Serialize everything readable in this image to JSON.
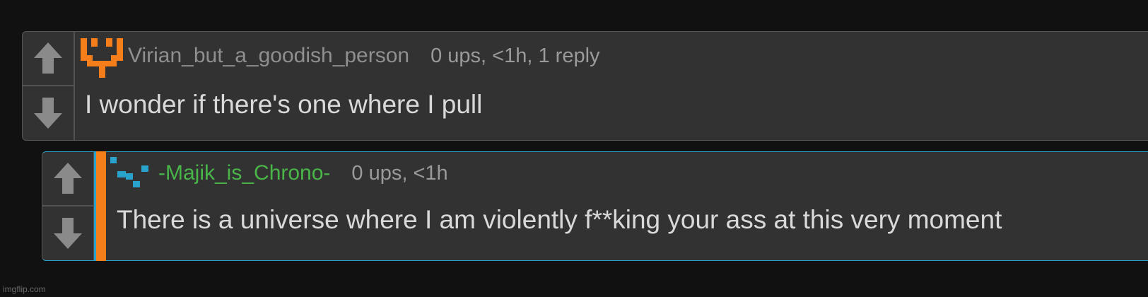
{
  "colors": {
    "page_bg": "#111112",
    "card_bg": "#323232",
    "accent_orange": "#f57d1a",
    "reply_border": "#29a3cc",
    "username_green": "#49b549",
    "text": "#d9d9d9",
    "muted": "#9a9a9a"
  },
  "comments": [
    {
      "avatar_icon": "orange-pixel-avatar-icon",
      "username": "Virian_but_a_goodish_person",
      "stats": "0 ups, <1h, 1 reply",
      "text": "I wonder if there's one where I pull",
      "upvote_icon": "arrow-up-icon",
      "downvote_icon": "arrow-down-icon"
    },
    {
      "avatar_icon": "blue-pixel-avatar-icon",
      "username": "-Majik_is_Chrono-",
      "stats": "0 ups, <1h",
      "text": "There is a universe where I am violently f**king your ass at this very moment",
      "upvote_icon": "arrow-up-icon",
      "downvote_icon": "arrow-down-icon"
    }
  ],
  "watermark": "imgflip.com"
}
